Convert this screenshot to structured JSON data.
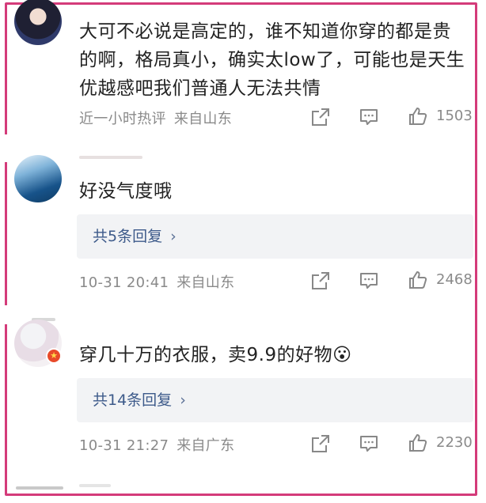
{
  "comments": [
    {
      "text": "大可不必说是高定的，谁不知道你穿的都是贵的啊，格局真小，确实太low了，可能也是天生优越感吧我们普通人无法共情",
      "time": "近一小时热评",
      "location": "来自山东",
      "likes": "1503"
    },
    {
      "text": "好没气度哦",
      "replies": "共5条回复",
      "time": "10-31 20:41",
      "location": "来自山东",
      "likes": "2468"
    },
    {
      "text": "穿几十万的衣服，卖9.9的好物😮",
      "replies": "共14条回复",
      "time": "10-31 21:27",
      "location": "来自广东",
      "likes": "2230"
    }
  ],
  "icons": {
    "share": "share-icon",
    "comment": "comment-icon",
    "like": "thumbs-up-icon",
    "chevron": "chevron-right-icon"
  },
  "colors": {
    "frame": "#d43b7a",
    "reply_text": "#3d5a8a",
    "meta_text": "#8a8a8a"
  }
}
